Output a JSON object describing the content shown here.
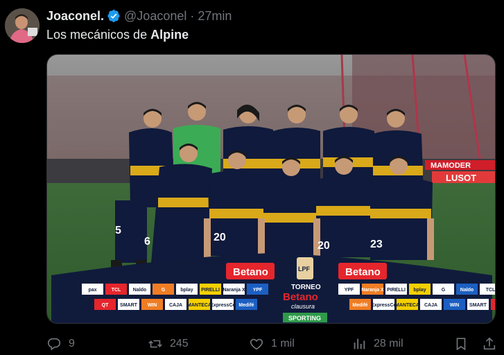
{
  "tweet": {
    "author": {
      "display_name": "Joaconel.",
      "handle": "@Joaconel",
      "verified": true
    },
    "separator": "·",
    "timestamp": "27min",
    "text_prefix": "Los mecánicos de ",
    "text_bold": "Alpine",
    "media": {
      "banner_text": {
        "sponsor_left": "Betano",
        "sponsor_right": "Betano",
        "tournament_line1": "TORNEO",
        "tournament_line2": "Betano",
        "tournament_line3": "clausura",
        "league_logo": "LPF",
        "footer_sponsor": "SPORTING",
        "ad_row1_left": [
          "pax",
          "TCL",
          "Naldo",
          "G",
          "bplay",
          "PIRELLI",
          "Naranja X",
          "YPF"
        ],
        "ad_row2_left": [
          "QT",
          "SMART",
          "WIN",
          "CAJA",
          "MANTECA",
          "ExpressCo",
          "Medifé"
        ],
        "ad_row1_right": [
          "YPF",
          "Naranja X",
          "PIRELLI",
          "bplay",
          "G",
          "Naldo",
          "TCL"
        ],
        "ad_row2_right": [
          "Medifé",
          "ExpressCo",
          "MANTECA",
          "CAJA",
          "WIN",
          "SMART",
          "QT"
        ],
        "stadium_sign": "MAMODER",
        "stadium_sign2": "LUSOT"
      },
      "jersey_numbers": [
        "5",
        "6",
        "20",
        "20",
        "23"
      ]
    },
    "actions": {
      "reply_count": "9",
      "repost_count": "245",
      "like_count": "1 mil",
      "view_count": "28 mil"
    }
  },
  "colors": {
    "background": "#000000",
    "text_primary": "#e7e9ea",
    "text_secondary": "#71767b",
    "verified_blue": "#1d9bf0",
    "kit_navy": "#0f1a3c",
    "kit_gold": "#d9a91a",
    "sponsor_red": "#e5262c"
  }
}
